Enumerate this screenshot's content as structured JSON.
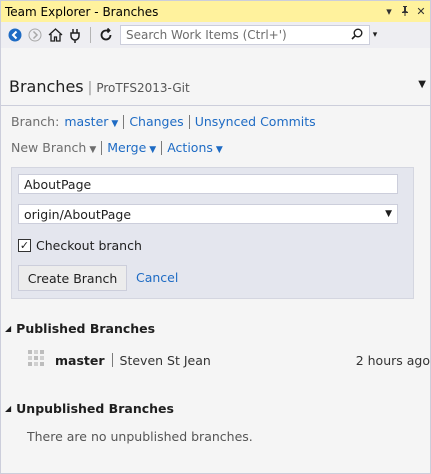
{
  "window": {
    "title": "Team Explorer - Branches",
    "title_controls": [
      "▾",
      "⊞",
      "✕"
    ]
  },
  "toolbar": {
    "search_placeholder": "Search Work Items (Ctrl+')",
    "icons": [
      "back-arrow-icon",
      "forward-arrow-icon",
      "home-icon",
      "connect-icon",
      "refresh-icon",
      "search-icon"
    ]
  },
  "header": {
    "title": "Branches",
    "project": "ProTFS2013-Git"
  },
  "branch_line": {
    "label": "Branch:",
    "current_branch": "master",
    "changes": "Changes",
    "unsynced": "Unsynced Commits"
  },
  "actions_line": {
    "new_branch": "New Branch",
    "merge": "Merge",
    "actions": "Actions"
  },
  "create_branch": {
    "name_value": "AboutPage",
    "source_value": "origin/AboutPage",
    "checkout_label": "Checkout branch",
    "checkout_checked": true,
    "create_label": "Create Branch",
    "cancel_label": "Cancel"
  },
  "published": {
    "title": "Published Branches",
    "rows": [
      {
        "branch": "master",
        "author": "Steven St Jean",
        "time": "2 hours ago"
      }
    ]
  },
  "unpublished": {
    "title": "Unpublished Branches",
    "empty_text": "There are no unpublished branches."
  },
  "colors": {
    "title_bar": "#fff29d",
    "link": "#1e6bc4",
    "accent_icon": "#1e6bc4"
  }
}
